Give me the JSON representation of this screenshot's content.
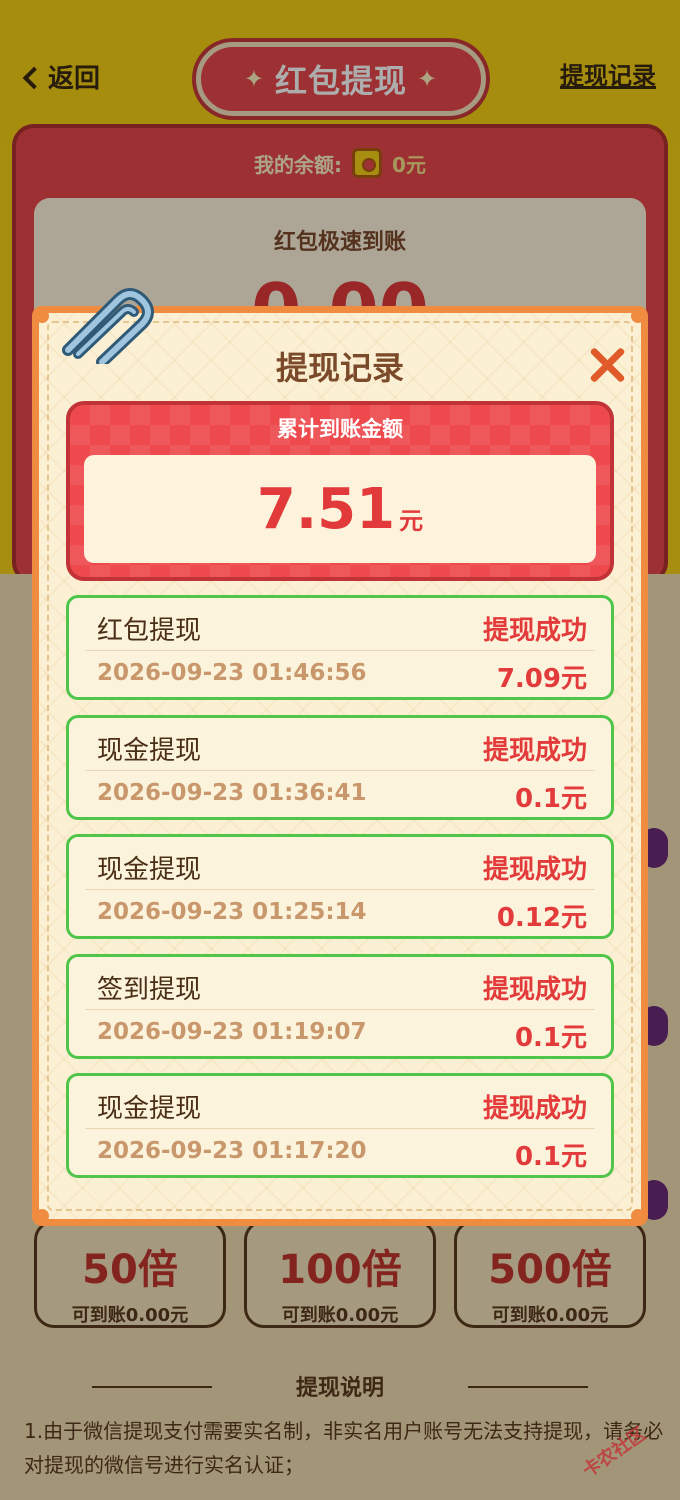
{
  "header": {
    "back_label": "返回",
    "title": "红包提现",
    "record_link": "提现记录"
  },
  "balance": {
    "label": "我的余额:",
    "value": "0元"
  },
  "main_card": {
    "subtitle": "红包极速到账",
    "amount": "0.00"
  },
  "multipliers": [
    {
      "label": "50倍",
      "sub": "可到账0.00元"
    },
    {
      "label": "100倍",
      "sub": "可到账0.00元"
    },
    {
      "label": "500倍",
      "sub": "可到账0.00元"
    }
  ],
  "explain": {
    "title": "提现说明",
    "text": "1.由于微信提现支付需要实名制，非实名用户账号无法支持提现，请务必对提现的微信号进行实名认证；"
  },
  "modal": {
    "title": "提现记录",
    "total_label": "累计到账金额",
    "total_amount": "7.51",
    "total_unit": "元",
    "records": [
      {
        "type": "红包提现",
        "status": "提现成功",
        "time": "2026-09-23 01:46:56",
        "amount": "7.09元"
      },
      {
        "type": "现金提现",
        "status": "提现成功",
        "time": "2026-09-23 01:36:41",
        "amount": "0.1元"
      },
      {
        "type": "现金提现",
        "status": "提现成功",
        "time": "2026-09-23 01:25:14",
        "amount": "0.12元"
      },
      {
        "type": "签到提现",
        "status": "提现成功",
        "time": "2026-09-23 01:19:07",
        "amount": "0.1元"
      },
      {
        "type": "现金提现",
        "status": "提现成功",
        "time": "2026-09-23 01:17:20",
        "amount": "0.1元"
      }
    ]
  },
  "watermark": "卡农社区",
  "colors": {
    "accent_red": "#e8474b",
    "success_green": "#4fc54a",
    "modal_border": "#f08c3f",
    "background_yellow": "#f5d015"
  }
}
